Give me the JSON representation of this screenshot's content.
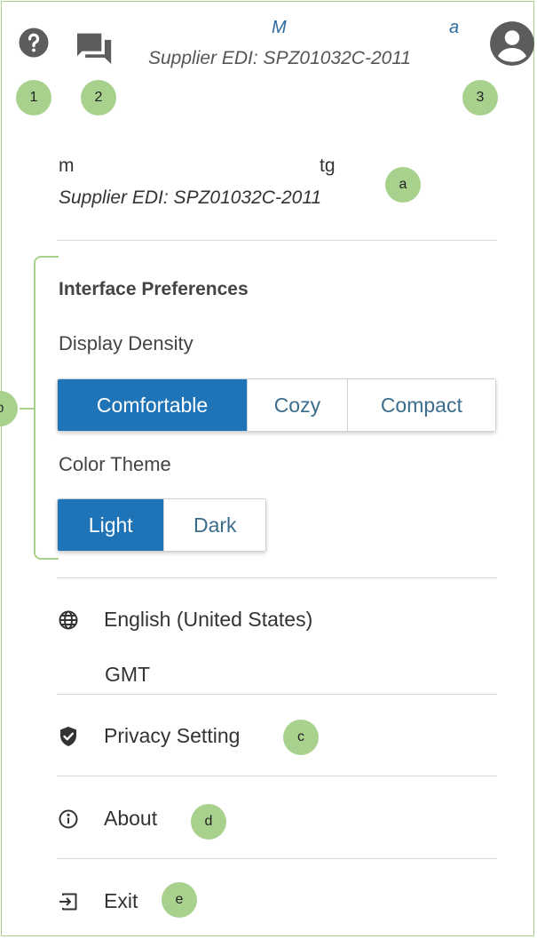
{
  "header": {
    "user_name_start": "M",
    "user_name_end": "a",
    "supplier_edi": "Supplier EDI: SPZ01032C-2011",
    "help_icon": "help-circle-icon",
    "chat_icon": "chat-icon",
    "account_icon": "account-circle-icon"
  },
  "annotations": {
    "one": "1",
    "two": "2",
    "three": "3",
    "a": "a",
    "b": "b",
    "c": "c",
    "d": "d",
    "e": "e",
    "color": "#a9d18e"
  },
  "account": {
    "name_start": "m",
    "name_end": "tg",
    "supplier_edi": "Supplier EDI: SPZ01032C-2011"
  },
  "preferences": {
    "title": "Interface Preferences",
    "density_label": "Display Density",
    "density_options": [
      "Comfortable",
      "Cozy",
      "Compact"
    ],
    "density_selected": "Comfortable",
    "theme_label": "Color Theme",
    "theme_options": [
      "Light",
      "Dark"
    ],
    "theme_selected": "Light",
    "accent_color": "#1f73b7"
  },
  "locale": {
    "language": "English (United States)",
    "timezone": "GMT",
    "icon": "globe-icon"
  },
  "menu": {
    "privacy": {
      "label": "Privacy Setting",
      "icon": "shield-check-icon"
    },
    "about": {
      "label": "About",
      "icon": "info-icon"
    },
    "exit": {
      "label": "Exit",
      "icon": "exit-icon"
    }
  }
}
